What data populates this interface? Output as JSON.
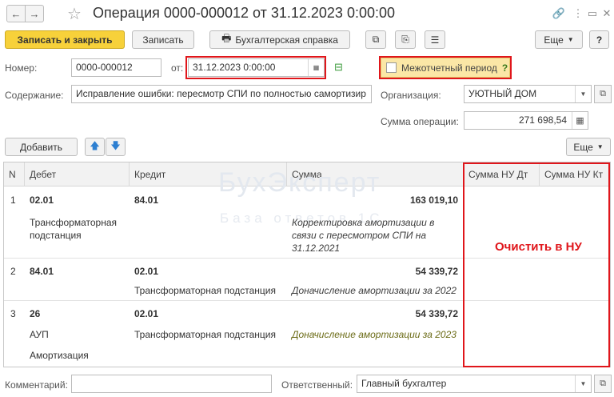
{
  "window": {
    "title": "Операция 0000-000012 от 31.12.2023 0:00:00"
  },
  "toolbar": {
    "post_close": "Записать и закрыть",
    "save": "Записать",
    "report": "Бухгалтерская справка",
    "more": "Еще",
    "help": "?"
  },
  "form": {
    "number_label": "Номер:",
    "number_value": "0000-000012",
    "date_label": "от:",
    "date_value": "31.12.2023  0:00:00",
    "interperiod_label": "Межотчетный период",
    "interperiod_help": "?",
    "interperiod_checked": false,
    "content_label": "Содержание:",
    "content_value": "Исправление ошибки: пересмотр СПИ по полностью самортизир",
    "org_label": "Организация:",
    "org_value": "УЮТНЫЙ ДОМ",
    "amount_label": "Сумма операции:",
    "amount_value": "271 698,54"
  },
  "table_toolbar": {
    "add": "Добавить",
    "more": "Еще"
  },
  "table": {
    "columns": [
      "N",
      "Дебет",
      "Кредит",
      "Сумма",
      "Сумма НУ Дт",
      "Сумма НУ Кт"
    ],
    "rows": [
      {
        "n": "1",
        "debit": "02.01",
        "debit_sub": [
          "Трансформаторная подстанция"
        ],
        "credit": "84.01",
        "credit_sub": [],
        "sum": "163 019,10",
        "description": "Корректировка амортизации в связи с пересмотром СПИ на 31.12.2021"
      },
      {
        "n": "2",
        "debit": "84.01",
        "debit_sub": [],
        "credit": "02.01",
        "credit_sub": [
          "Трансформаторная подстанция"
        ],
        "sum": "54 339,72",
        "description": "Доначисление амортизации за 2022"
      },
      {
        "n": "3",
        "debit": "26",
        "debit_sub": [
          "АУП",
          "Амортизация"
        ],
        "credit": "02.01",
        "credit_sub": [
          "Трансформаторная подстанция"
        ],
        "sum": "54 339,72",
        "description": "Доначисление амортизации за 2023"
      }
    ]
  },
  "annotation": {
    "clear_nu": "Очистить в НУ"
  },
  "watermark": {
    "line1": "БухЭксперт",
    "line2": "База ответов 1С"
  },
  "footer": {
    "comment_label": "Комментарий:",
    "comment_value": "",
    "responsible_label": "Ответственный:",
    "responsible_value": "Главный бухгалтер"
  },
  "colors": {
    "accent_yellow": "#f7d13a",
    "highlight_red": "#e0161b",
    "olive_text": "#6b6b16"
  }
}
